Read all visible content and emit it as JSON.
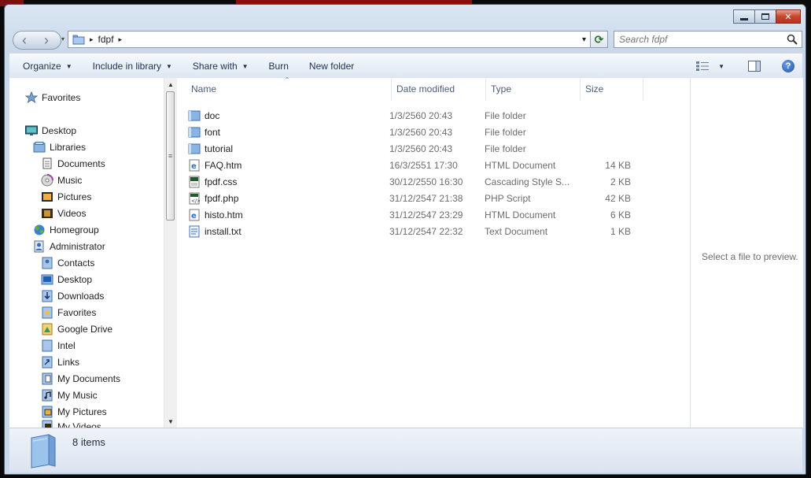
{
  "window": {
    "buttons": {
      "minimize": "▭",
      "maximize": "❐",
      "close": "✕"
    }
  },
  "address": {
    "back_icon": "‹",
    "forward_icon": "›",
    "dropdown_icon": "▾",
    "path_root_icon": "folder-icon",
    "separator": "▸",
    "crumb": "fdpf",
    "trailing_separator": "▸",
    "refresh_icon": "⟳"
  },
  "search": {
    "placeholder": "Search fdpf"
  },
  "toolbar": {
    "organize": "Organize",
    "include_in_library": "Include in library",
    "share_with": "Share with",
    "burn": "Burn",
    "new_folder": "New folder",
    "dropdown_arrow": "▼",
    "help_icon": "?"
  },
  "nav": {
    "items": [
      {
        "label": "Favorites",
        "icon": "star-icon"
      },
      {
        "label": "Desktop",
        "icon": "desktop-icon"
      },
      {
        "label": "Libraries",
        "icon": "library-icon"
      },
      {
        "label": "Documents",
        "icon": "documents-icon"
      },
      {
        "label": "Music",
        "icon": "music-icon"
      },
      {
        "label": "Pictures",
        "icon": "pictures-icon"
      },
      {
        "label": "Videos",
        "icon": "videos-icon"
      },
      {
        "label": "Homegroup",
        "icon": "homegroup-icon"
      },
      {
        "label": "Administrator",
        "icon": "user-icon"
      },
      {
        "label": "Contacts",
        "icon": "contacts-icon"
      },
      {
        "label": "Desktop",
        "icon": "desktop-icon"
      },
      {
        "label": "Downloads",
        "icon": "downloads-icon"
      },
      {
        "label": "Favorites",
        "icon": "favorites-icon"
      },
      {
        "label": "Google Drive",
        "icon": "google-drive-icon"
      },
      {
        "label": "Intel",
        "icon": "folder-icon"
      },
      {
        "label": "Links",
        "icon": "links-icon"
      },
      {
        "label": "My Documents",
        "icon": "documents-icon"
      },
      {
        "label": "My Music",
        "icon": "music-icon"
      },
      {
        "label": "My Pictures",
        "icon": "pictures-icon"
      },
      {
        "label": "My Videos",
        "icon": "videos-icon"
      }
    ],
    "scroll_up": "▲",
    "scroll_down": "▼",
    "grip": "≡"
  },
  "columns": {
    "name": "Name",
    "date": "Date modified",
    "type": "Type",
    "size": "Size",
    "sort_indicator": "ˆ"
  },
  "files": [
    {
      "name": "doc",
      "date": "1/3/2560 20:43",
      "type": "File folder",
      "size": "",
      "icon": "folder-icon"
    },
    {
      "name": "font",
      "date": "1/3/2560 20:43",
      "type": "File folder",
      "size": "",
      "icon": "folder-icon"
    },
    {
      "name": "tutorial",
      "date": "1/3/2560 20:43",
      "type": "File folder",
      "size": "",
      "icon": "folder-icon"
    },
    {
      "name": "FAQ.htm",
      "date": "16/3/2551 17:30",
      "type": "HTML Document",
      "size": "14 KB",
      "icon": "ie-document-icon"
    },
    {
      "name": "fpdf.css",
      "date": "30/12/2550 16:30",
      "type": "Cascading Style S...",
      "size": "2 KB",
      "icon": "css-file-icon"
    },
    {
      "name": "fpdf.php",
      "date": "31/12/2547 21:38",
      "type": "PHP Script",
      "size": "42 KB",
      "icon": "php-file-icon"
    },
    {
      "name": "histo.htm",
      "date": "31/12/2547 23:29",
      "type": "HTML Document",
      "size": "6 KB",
      "icon": "ie-document-icon"
    },
    {
      "name": "install.txt",
      "date": "31/12/2547 22:32",
      "type": "Text Document",
      "size": "1 KB",
      "icon": "text-file-icon"
    }
  ],
  "preview": {
    "message": "Select a file to preview."
  },
  "details": {
    "count": "8 items"
  }
}
